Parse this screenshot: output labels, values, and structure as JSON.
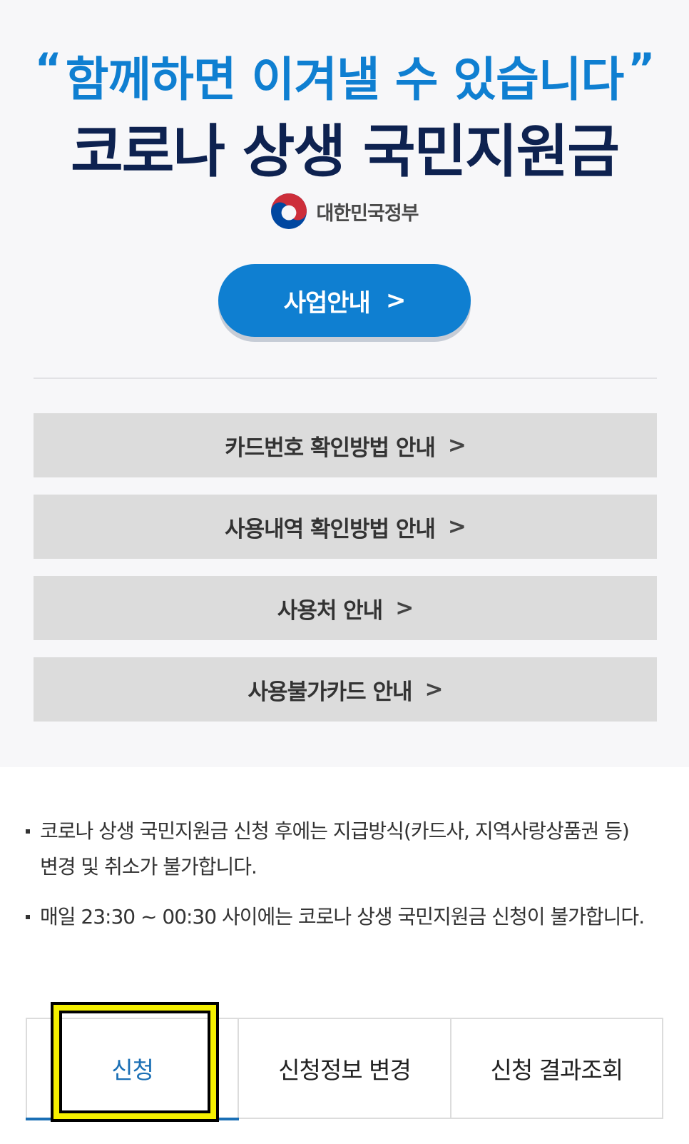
{
  "hero": {
    "quote_open": "“",
    "slogan": "함께하면 이겨낼 수 있습니다",
    "quote_close": "”",
    "title": "코로나 상생 국민지원금",
    "gov_name": "대한민국정부",
    "gov_icon": "taegeuk-emblem-icon",
    "biz_button_label": "사업안내",
    "chevron": ">"
  },
  "info_buttons": [
    {
      "label": "카드번호 확인방법 안내"
    },
    {
      "label": "사용내역 확인방법 안내"
    },
    {
      "label": "사용처 안내"
    },
    {
      "label": "사용불가카드 안내"
    }
  ],
  "notices": [
    "코로나 상생 국민지원금 신청 후에는 지급방식(카드사, 지역사랑상품권 등) 변경 및 취소가 불가합니다.",
    "매일 23:30 ~ 00:30 사이에는 코로나 상생 국민지원금 신청이 불가합니다."
  ],
  "tabs": [
    {
      "label": "신청",
      "active": true
    },
    {
      "label": "신청정보 변경",
      "active": false
    },
    {
      "label": "신청 결과조회",
      "active": false
    }
  ],
  "colors": {
    "accent_blue": "#0f7fd1",
    "title_navy": "#0e2250",
    "button_gray": "#dcdcdc",
    "highlight_yellow": "#f5f000",
    "emblem_red": "#cd2e3a",
    "emblem_blue": "#0047a0"
  }
}
